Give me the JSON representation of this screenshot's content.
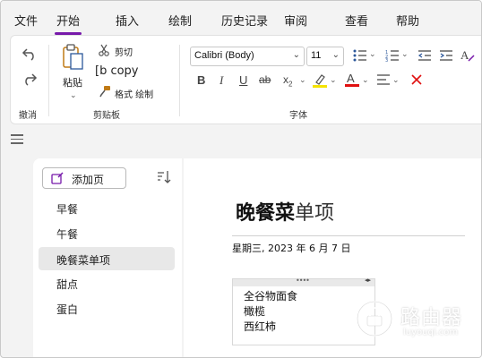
{
  "menu": {
    "tabs": [
      {
        "label": "文件"
      },
      {
        "label": "开始"
      },
      {
        "label": "插入"
      },
      {
        "label": "绘制"
      },
      {
        "label": "历史记录"
      },
      {
        "label": "审阅"
      },
      {
        "label": "查看"
      },
      {
        "label": "帮助"
      }
    ],
    "active_tab": "开始",
    "accent_color": "#7719aa"
  },
  "ribbon": {
    "undo_group_label": "撤消",
    "clipboard": {
      "paste_label": "粘贴",
      "cut_label": "剪切",
      "copy_label": "[b copy",
      "format_painter_label": "格式 绘制",
      "group_label": "剪贴板"
    },
    "font": {
      "font_name": "Calibri (Body)",
      "font_size": "11",
      "group_label": "字体",
      "highlight_color": "#f5e300",
      "font_color": "#e01010"
    }
  },
  "pages": {
    "add_page_label": "添加页",
    "items": [
      {
        "label": "早餐"
      },
      {
        "label": "午餐"
      },
      {
        "label": "晚餐菜单项"
      },
      {
        "label": "甜点"
      },
      {
        "label": "蛋白"
      }
    ],
    "selected_index": 2
  },
  "note": {
    "title_bold": "晚餐菜",
    "title_light": "单项",
    "date": "星期三, 2023 年 6 月 7 日",
    "lines": [
      "全谷物面食",
      "橄榄",
      "西红柿"
    ]
  },
  "watermark": {
    "text": "路由器",
    "sub": "luyouqi.com"
  }
}
